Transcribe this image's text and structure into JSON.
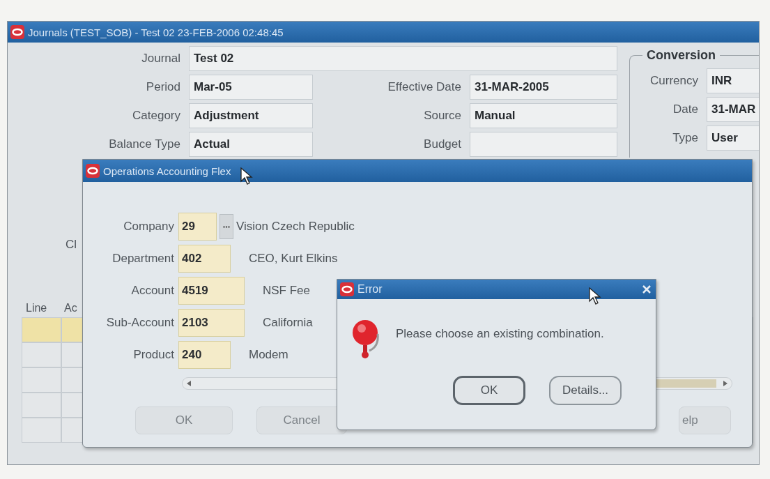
{
  "main_window": {
    "title": "Journals (TEST_SOB) - Test 02 23-FEB-2006 02:48:45",
    "journal": {
      "label": "Journal",
      "value": "Test 02"
    },
    "rows": [
      {
        "label": "Period",
        "value": "Mar-05",
        "label2": "Effective Date",
        "value2": "31-MAR-2005"
      },
      {
        "label": "Category",
        "value": "Adjustment",
        "label2": "Source",
        "value2": "Manual"
      },
      {
        "label": "Balance Type",
        "value": "Actual",
        "label2": "Budget"
      }
    ],
    "conversion": {
      "title": "Conversion",
      "fields": [
        {
          "label": "Currency",
          "value": "INR"
        },
        {
          "label": "Date",
          "value": "31-MAR"
        },
        {
          "label": "Type",
          "value": "User"
        }
      ]
    },
    "partial_label": "Cl",
    "table": {
      "columns": [
        "Line",
        "Ac"
      ],
      "rows": [
        {
          "selected": true
        },
        {
          "selected": false
        },
        {
          "selected": false
        },
        {
          "selected": false
        },
        {
          "selected": false
        }
      ]
    }
  },
  "flex_dialog": {
    "title": "Operations Accounting Flex",
    "segments": [
      {
        "label": "Company",
        "value": "29",
        "list_button": true,
        "description": "Vision Czech Republic"
      },
      {
        "label": "Department",
        "value": "402",
        "list_button": false,
        "description": "CEO, Kurt Elkins"
      },
      {
        "label": "Account",
        "value": "4519",
        "list_button": false,
        "description": "NSF Fee"
      },
      {
        "label": "Sub-Account",
        "value": "2103",
        "list_button": false,
        "description": "California"
      },
      {
        "label": "Product",
        "value": "240",
        "list_button": false,
        "description": "Modem"
      }
    ],
    "buttons": [
      "OK",
      "Cancel"
    ],
    "help_button": "elp"
  },
  "error_dialog": {
    "title": "Error",
    "message": "Please choose an existing combination.",
    "buttons": [
      {
        "label": "OK",
        "default": true
      },
      {
        "label": "Details...",
        "default": false
      }
    ]
  }
}
